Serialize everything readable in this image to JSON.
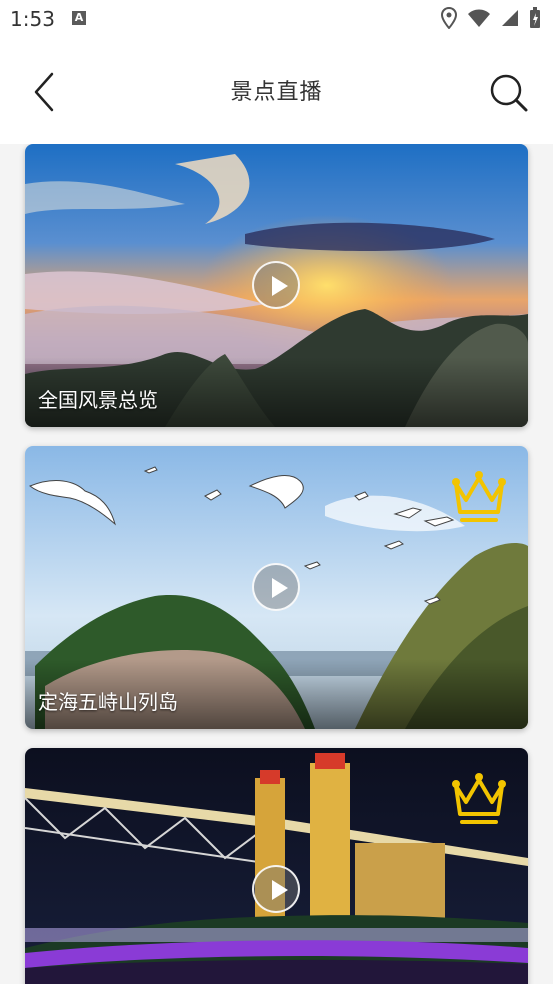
{
  "status": {
    "time": "1:53",
    "notification_badge": "A"
  },
  "header": {
    "title": "景点直播",
    "back_icon": "chevron-left-icon",
    "search_icon": "search-icon"
  },
  "cards": [
    {
      "title": "全国风景总览",
      "premium": false
    },
    {
      "title": "定海五峙山列岛",
      "premium": true
    },
    {
      "title": "",
      "premium": true
    }
  ],
  "colors": {
    "crown": "#f2c400",
    "text_dark": "#333333",
    "list_bg": "#f4f4f4"
  }
}
